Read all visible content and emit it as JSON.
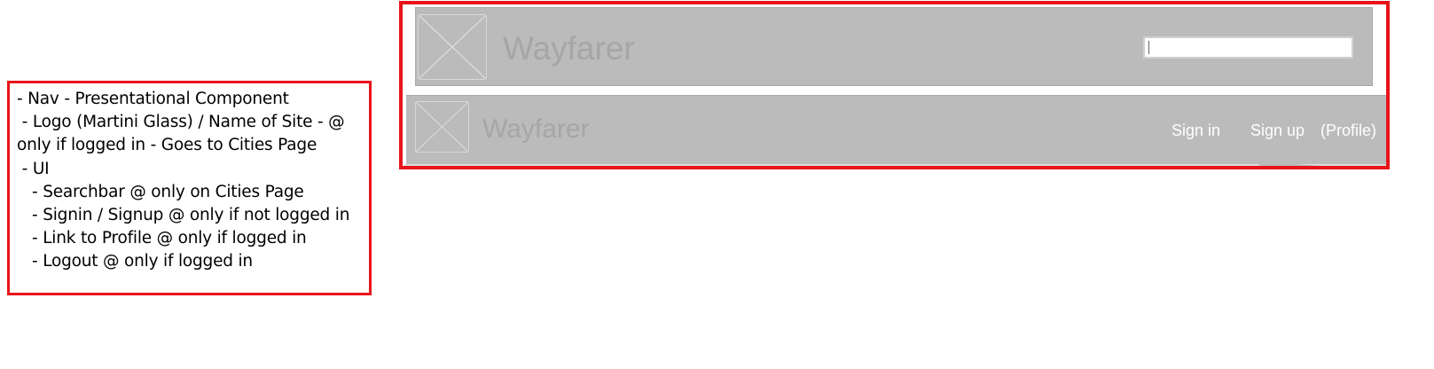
{
  "annotation": {
    "lines": [
      "- Nav - Presentational Component",
      " - Logo (Martini Glass) / Name of Site - @",
      "only if logged in - Goes to Cities Page",
      " - UI",
      "   - Searchbar @ only on Cities Page",
      "   - Signin / Signup @ only if not logged in",
      "   - Link to Profile @ only if logged in",
      "   - Logout @ only if logged in"
    ]
  },
  "mockup": {
    "bar1": {
      "site_name": "Wayfarer",
      "search_placeholder": ""
    },
    "bar2": {
      "site_name": "Wayfarer",
      "links": [
        "Sign in",
        "Sign up",
        "(Profile)"
      ]
    }
  },
  "colors": {
    "annotation_border": "#e8141b",
    "nav_background": "#bbbbbb",
    "site_name_text": "#a6a6a6",
    "link_text": "#ffffff"
  },
  "icons": {
    "logo_placeholder": "image-placeholder-icon"
  }
}
